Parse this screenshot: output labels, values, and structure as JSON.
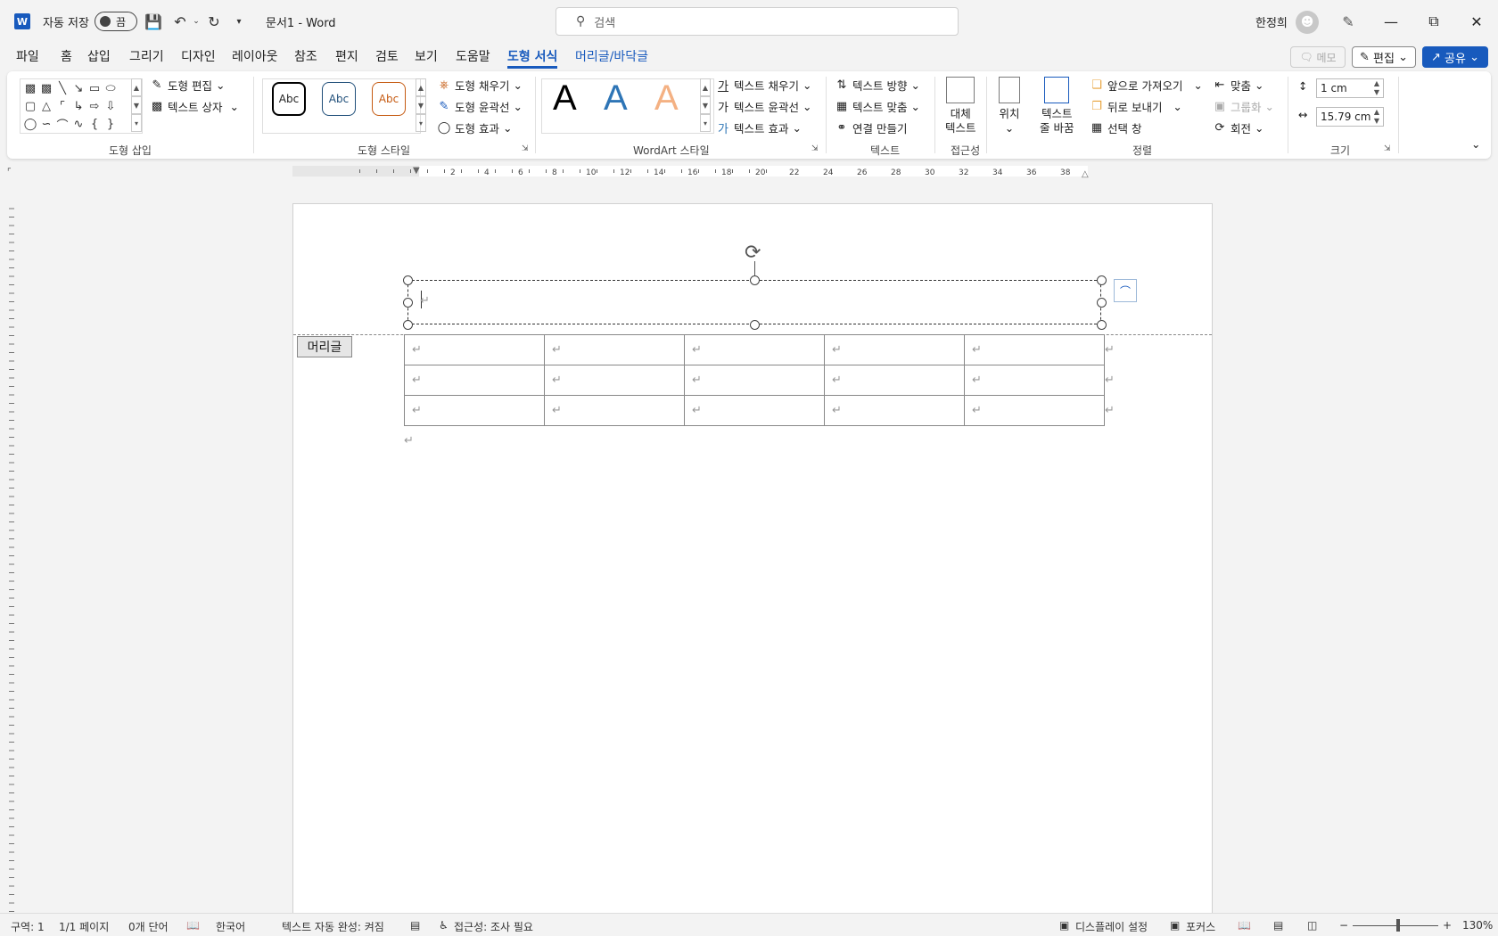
{
  "titlebar": {
    "app_icon": "W",
    "autosave_label": "자동 저장",
    "autosave_state": "끔",
    "doc_title": "문서1 - Word",
    "search_placeholder": "검색",
    "user_name": "한정희"
  },
  "menu": {
    "tabs": [
      "파일",
      "홈",
      "삽입",
      "그리기",
      "디자인",
      "레이아웃",
      "참조",
      "편지",
      "검토",
      "보기",
      "도움말",
      "도형 서식",
      "머리글/바닥글"
    ],
    "memo": "메모",
    "edit": "편집",
    "share": "공유"
  },
  "ribbon": {
    "insert_shapes": {
      "label": "도형 삽입",
      "edit_shape": "도형 편집",
      "text_box": "텍스트 상자"
    },
    "shape_styles": {
      "label": "도형 스타일",
      "swatch_text": "Abc",
      "fill": "도형 채우기",
      "outline": "도형 윤곽선",
      "effects": "도형 효과"
    },
    "wordart": {
      "label": "WordArt 스타일",
      "letter": "A",
      "text_fill": "텍스트 채우기",
      "text_outline": "텍스트 윤곽선",
      "text_effects": "텍스트 효과"
    },
    "text": {
      "label": "텍스트",
      "direction": "텍스트 방향",
      "align": "텍스트 맞춤",
      "link": "연결 만들기"
    },
    "accessibility": {
      "label": "접근성",
      "alt_text_line1": "대체",
      "alt_text_line2": "텍스트"
    },
    "arrange": {
      "label": "정렬",
      "position": "위치",
      "wrap_line1": "텍스트",
      "wrap_line2": "줄 바꿈",
      "bring_forward": "앞으로 가져오기",
      "send_backward": "뒤로 보내기",
      "selection_pane": "선택 창",
      "align": "맞춤",
      "group": "그룹화",
      "rotate": "회전"
    },
    "size": {
      "label": "크기",
      "height": "1 cm",
      "width": "15.79 cm"
    }
  },
  "document": {
    "header_tag": "머리글",
    "table_rows": 3,
    "table_cols": 5,
    "para_mark": "↵"
  },
  "ruler_numbers": [
    "2",
    "4",
    "6",
    "8",
    "10",
    "12",
    "14",
    "16",
    "18",
    "20",
    "22",
    "24",
    "26",
    "28",
    "30",
    "32",
    "34",
    "36",
    "38"
  ],
  "status": {
    "section": "구역: 1",
    "page": "1/1 페이지",
    "words": "0개 단어",
    "language": "한국어",
    "autocomplete": "텍스트 자동 완성: 켜짐",
    "accessibility": "접근성: 조사 필요",
    "display": "디스플레이 설정",
    "focus": "포커스",
    "zoom": "130%"
  },
  "colors": {
    "accent": "#185abd",
    "style_black": "#000000",
    "style_blue": "#1f4e79",
    "style_orange": "#c55a11",
    "wordart_blue": "#2e75b6",
    "wordart_orange": "#f4b183"
  }
}
